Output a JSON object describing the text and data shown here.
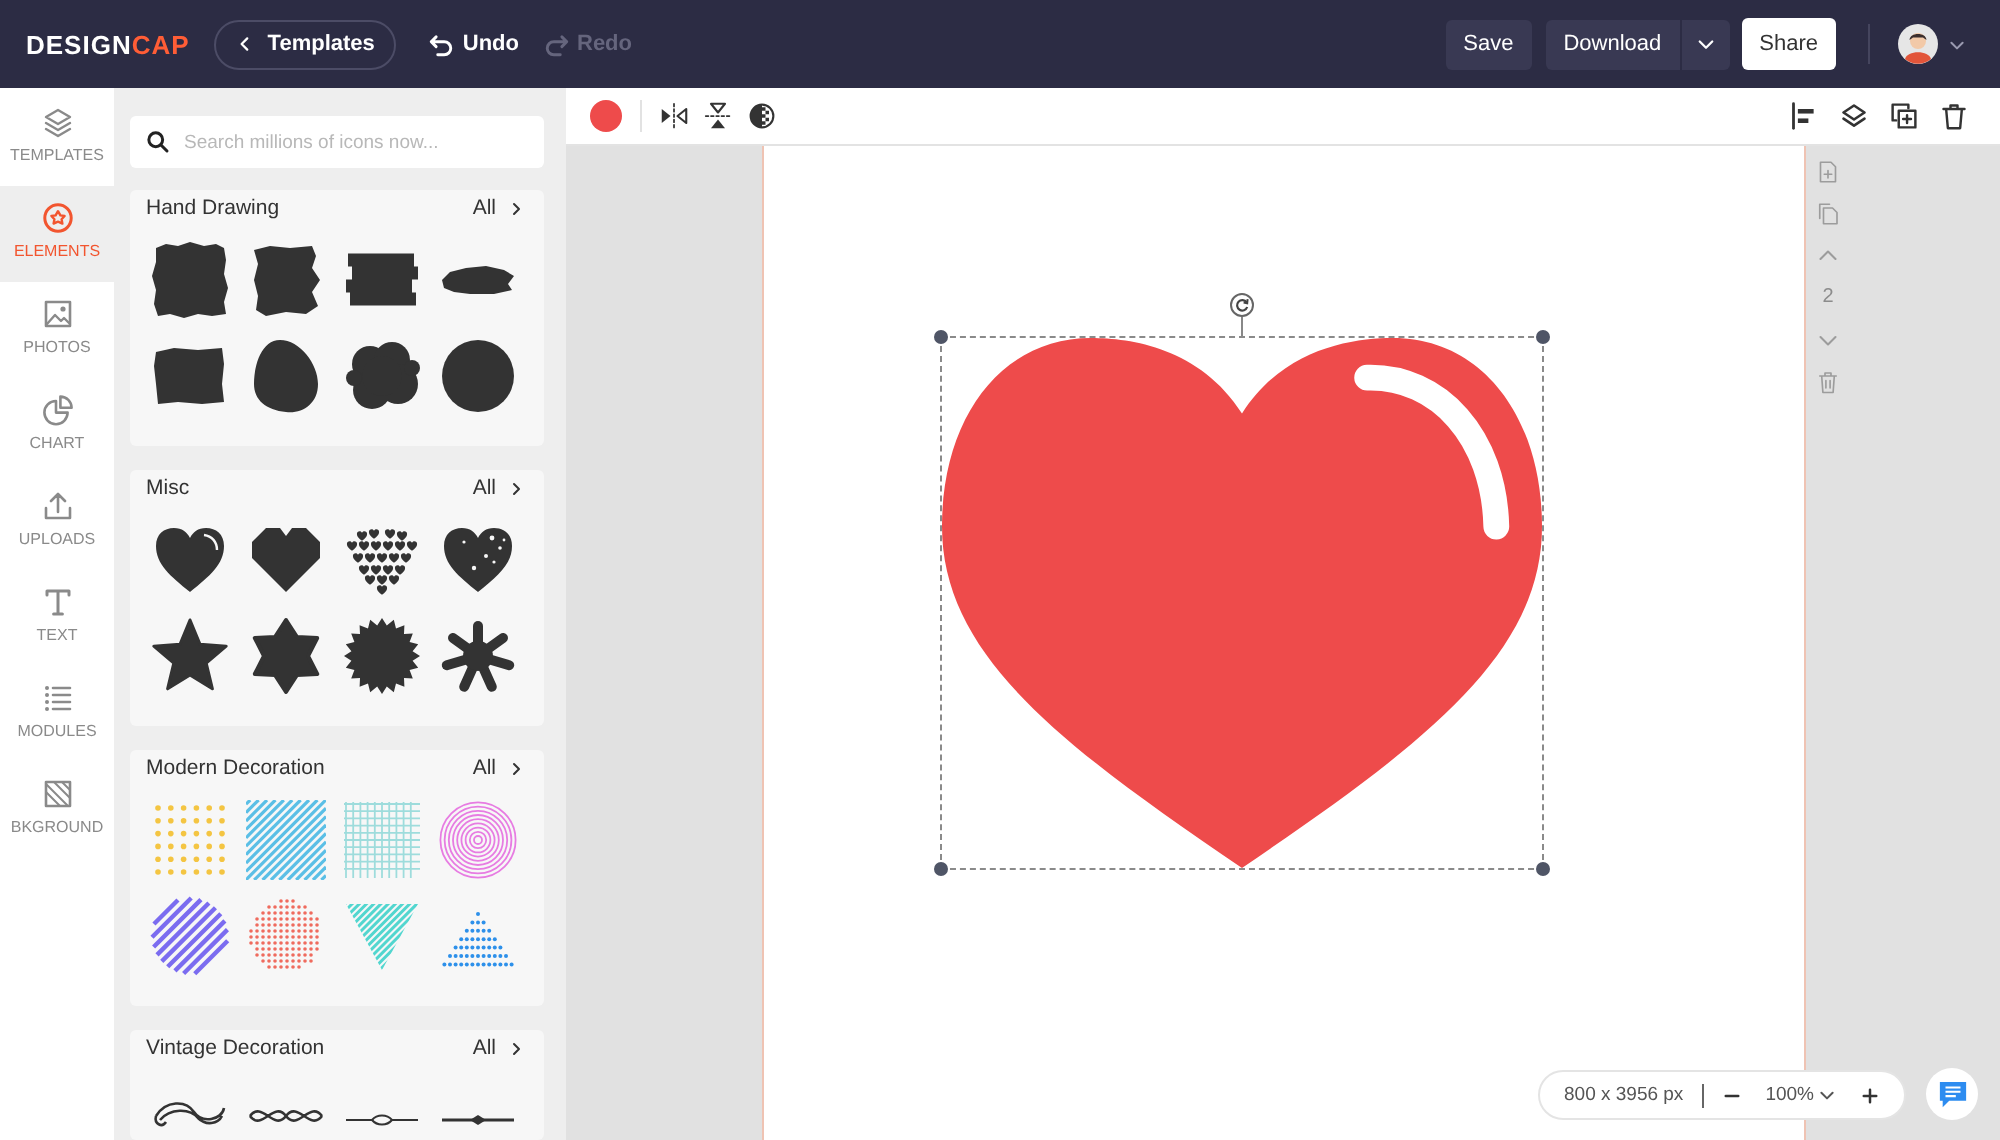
{
  "topbar": {
    "logo": {
      "main": "DESIGN",
      "accent": "CAP"
    },
    "back_button": "Templates",
    "history": [
      {
        "kind": "undo",
        "label": "Undo",
        "disabled": false
      },
      {
        "kind": "redo",
        "label": "Redo",
        "disabled": true
      }
    ],
    "save": "Save",
    "download": "Download",
    "share": "Share"
  },
  "sidebar": {
    "items": [
      {
        "kind": "templates",
        "label": "TEMPLATES",
        "selected": false
      },
      {
        "kind": "elements",
        "label": "ELEMENTS",
        "selected": true
      },
      {
        "kind": "photos",
        "label": "PHOTOS",
        "selected": false
      },
      {
        "kind": "chart",
        "label": "CHART",
        "selected": false
      },
      {
        "kind": "uploads",
        "label": "UPLOADS",
        "selected": false
      },
      {
        "kind": "text",
        "label": "TEXT",
        "selected": false
      },
      {
        "kind": "modules",
        "label": "MODULES",
        "selected": false
      },
      {
        "kind": "background",
        "label": "BKGROUND",
        "selected": false
      }
    ]
  },
  "panel": {
    "search": {
      "placeholder": "Search millions of icons now..."
    },
    "sections": [
      {
        "kind": "brush",
        "title": "Hand Drawing",
        "link": "All"
      },
      {
        "kind": "misc",
        "title": "Misc",
        "link": "All"
      },
      {
        "kind": "modern",
        "title": "Modern Decoration",
        "link": "All"
      },
      {
        "kind": "vintage",
        "title": "Vintage Decoration",
        "link": "All"
      }
    ]
  },
  "canvas": {
    "element": {
      "kind": "heart",
      "color": "#ee4b4b",
      "selected": true
    },
    "page_number": "2",
    "size": "800 x 3956 px",
    "zoom": "100%"
  }
}
